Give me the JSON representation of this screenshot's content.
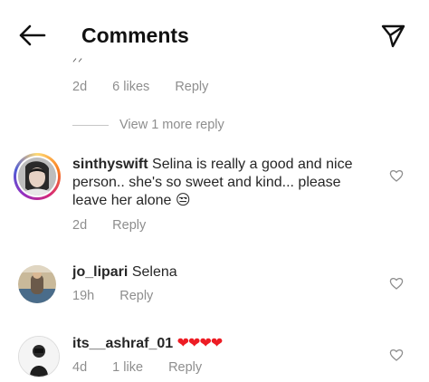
{
  "header": {
    "title": "Comments"
  },
  "partial_comment": {
    "cut_text": "ᐟᐟ",
    "time": "2d",
    "likes": "6 likes",
    "reply": "Reply"
  },
  "view_more": "View 1 more reply",
  "comments": [
    {
      "username": "sinthyswift",
      "text": "Selina is really a good and nice person.. she's so sweet and kind... please leave her alone",
      "emoji": "😒",
      "time": "2d",
      "reply": "Reply"
    },
    {
      "username": "jo_lipari",
      "text": "Selena",
      "time": "19h",
      "reply": "Reply"
    },
    {
      "username": "its__ashraf_01",
      "text": "❤❤❤❤",
      "time": "4d",
      "likes": "1 like",
      "reply": "Reply"
    }
  ],
  "colors": {
    "meta": "#8e8e8e",
    "text": "#262626",
    "heart_red": "#ed1c24"
  }
}
